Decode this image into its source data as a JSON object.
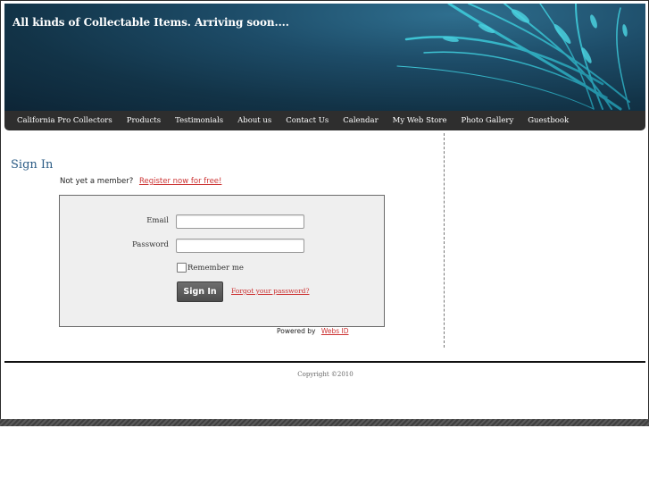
{
  "header": {
    "title": "All kinds of Collectable Items. Arriving soon...."
  },
  "nav": {
    "items": [
      "California Pro Collectors",
      "Products",
      "Testimonials",
      "About us",
      "Contact Us",
      "Calendar",
      "My Web Store",
      "Photo Gallery",
      "Guestbook"
    ]
  },
  "signin": {
    "title": "Sign In",
    "not_member_text": "Not yet a member?",
    "register_link": "Register now for free!",
    "email_label": "Email",
    "email_value": "",
    "password_label": "Password",
    "password_value": "",
    "remember_label": "Remember me",
    "remember_checked": false,
    "button_label": "Sign In",
    "forgot_link": "Forgot your password?"
  },
  "powered": {
    "text": "Powered by",
    "link": "Webs ID"
  },
  "footer": {
    "copyright": "Copyright ©2010"
  },
  "colors": {
    "header_dark": "#123347",
    "nav_bg": "#2e2e2e",
    "link": "#cc3333",
    "title": "#2d5d86",
    "form_bg": "#efefef"
  }
}
